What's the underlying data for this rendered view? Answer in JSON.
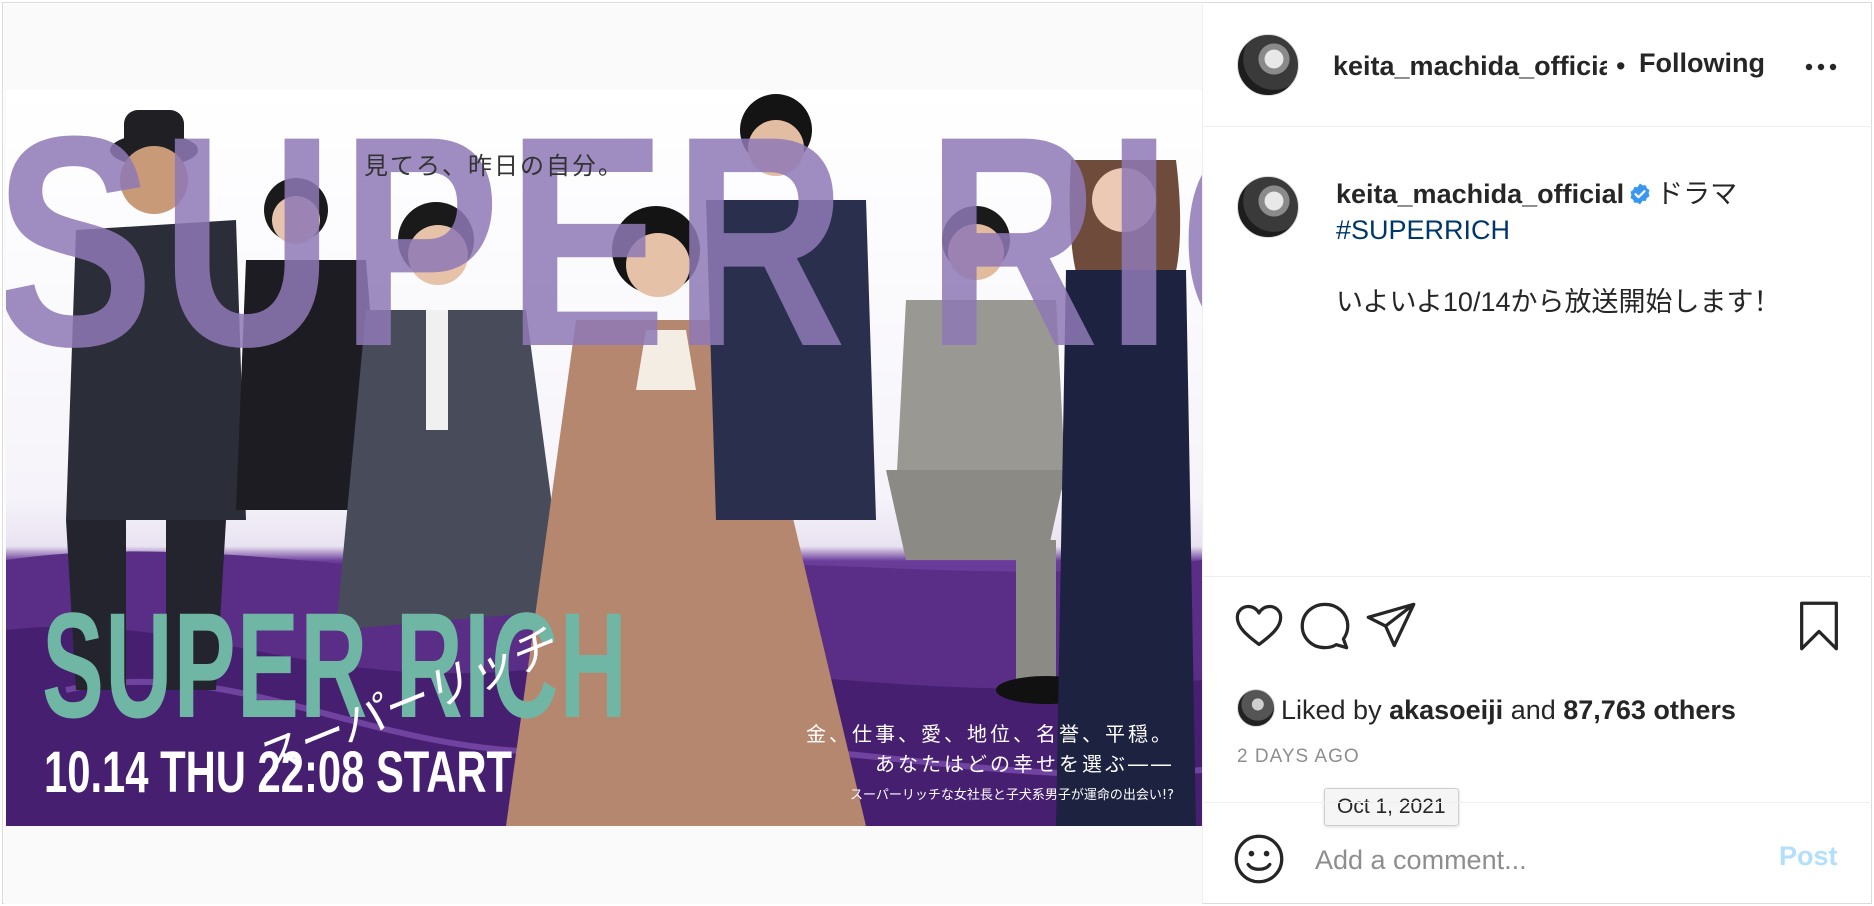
{
  "poster": {
    "bg_title": "SUPER RICH",
    "tagline": "見てろ、昨日の自分。",
    "logo": "SUPER RICH",
    "logo_kana": "スーパーリッチ",
    "start_line": "10.14 THU 22:08 START",
    "copy_line_1": "金、仕事、愛、地位、名誉、平穏。",
    "copy_line_2": "あなたはどの幸せを選ぶ――",
    "copy_line_3": "スーパーリッチな女社長と子犬系男子が運命の出会い!?"
  },
  "header": {
    "username": "keita_machida_official",
    "separator": "•",
    "follow_label": "Following"
  },
  "caption": {
    "username": "keita_machida_official",
    "lead": "ドラマ",
    "hashtag": "#SUPERRICH",
    "body": "いよいよ10/14から放送開始します！"
  },
  "icons": {
    "like": "heart-icon",
    "comment": "comment-icon",
    "share": "paper-plane-icon",
    "save": "bookmark-icon",
    "more": "more-icon",
    "emoji": "emoji-icon",
    "verified": "verified-badge-icon"
  },
  "likes": {
    "prefix": "Liked by",
    "user": "akasoeiji",
    "joiner": "and",
    "count_text": "87,763 others"
  },
  "timestamp": {
    "relative": "2 DAYS AGO",
    "tooltip": "Oct 1, 2021"
  },
  "comment": {
    "placeholder": "Add a comment...",
    "post_label": "Post"
  },
  "colors": {
    "link": "#00376b",
    "verified": "#3897f0",
    "post_disabled": "#b2dffc",
    "poster_purple": "#5a2d86",
    "logo_teal": "#6fb7a4"
  }
}
